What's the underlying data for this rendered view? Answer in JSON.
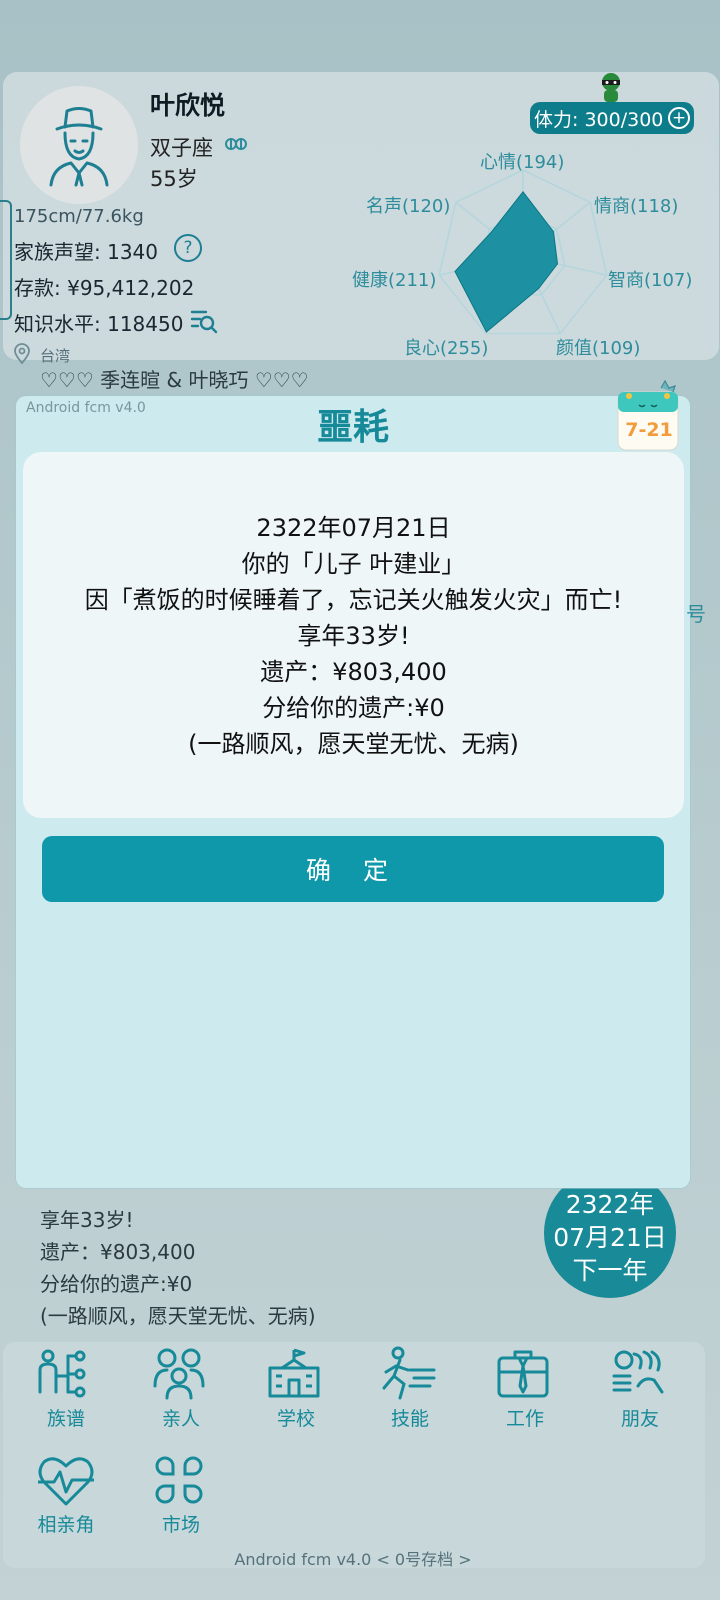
{
  "profile": {
    "name": "叶欣悦",
    "zodiac": "双子座",
    "age": "55岁",
    "height_weight": "175cm/77.6kg",
    "family_prestige": "家族声望: 1340",
    "savings": "存款: ¥95,412,202",
    "knowledge": "知识水平: 118450",
    "location": "台湾",
    "stamina": "体力: 300/300"
  },
  "radar": {
    "stats": [
      {
        "label": "心情(194)",
        "value": 194
      },
      {
        "label": "情商(118)",
        "value": 118
      },
      {
        "label": "智商(107)",
        "value": 107
      },
      {
        "label": "颜值(109)",
        "value": 109
      },
      {
        "label": "良心(255)",
        "value": 255
      },
      {
        "label": "健康(211)",
        "value": 211
      },
      {
        "label": "名声(120)",
        "value": 120
      }
    ],
    "fill_color": "#0e8b9b"
  },
  "couple_line": "♡♡♡ 季连暄 & 叶晓巧 ♡♡♡",
  "modal": {
    "version": "Android fcm v4.0",
    "title": "噩耗",
    "calendar_date": "7-21",
    "lines": [
      "2322年07月21日",
      "你的「儿子 叶建业」",
      "因「煮饭的时候睡着了，忘记关火触发火灾」而亡!",
      "享年33岁!",
      "遗产：¥803,400",
      "分给你的遗产:¥0",
      "(一路顺风，愿天堂无忧、无病)"
    ],
    "confirm_label": "确 定"
  },
  "side_char": "号",
  "log_lines": [
    "因「煮饭的时候睡着了，忘记关火触发火灾」而亡!",
    "享年33岁!",
    "遗产：¥803,400",
    "分给你的遗产:¥0",
    "(一路顺风，愿天堂无忧、无病)"
  ],
  "date_badge": {
    "year": "2322年",
    "date": "07月21日",
    "next": "下一年"
  },
  "nav": [
    {
      "label": "族谱",
      "icon": "family-tree-icon"
    },
    {
      "label": "亲人",
      "icon": "relatives-icon"
    },
    {
      "label": "学校",
      "icon": "school-icon"
    },
    {
      "label": "技能",
      "icon": "skills-icon"
    },
    {
      "label": "工作",
      "icon": "briefcase-icon"
    },
    {
      "label": "朋友",
      "icon": "friends-icon"
    },
    {
      "label": "相亲角",
      "icon": "heart-pulse-icon"
    },
    {
      "label": "市场",
      "icon": "market-icon"
    }
  ],
  "footer": "Android fcm v4.0 < 0号存档 >",
  "colors": {
    "accent": "#0e98aa",
    "teal_text": "#178a99",
    "modal_bg": "#cdeaee"
  }
}
